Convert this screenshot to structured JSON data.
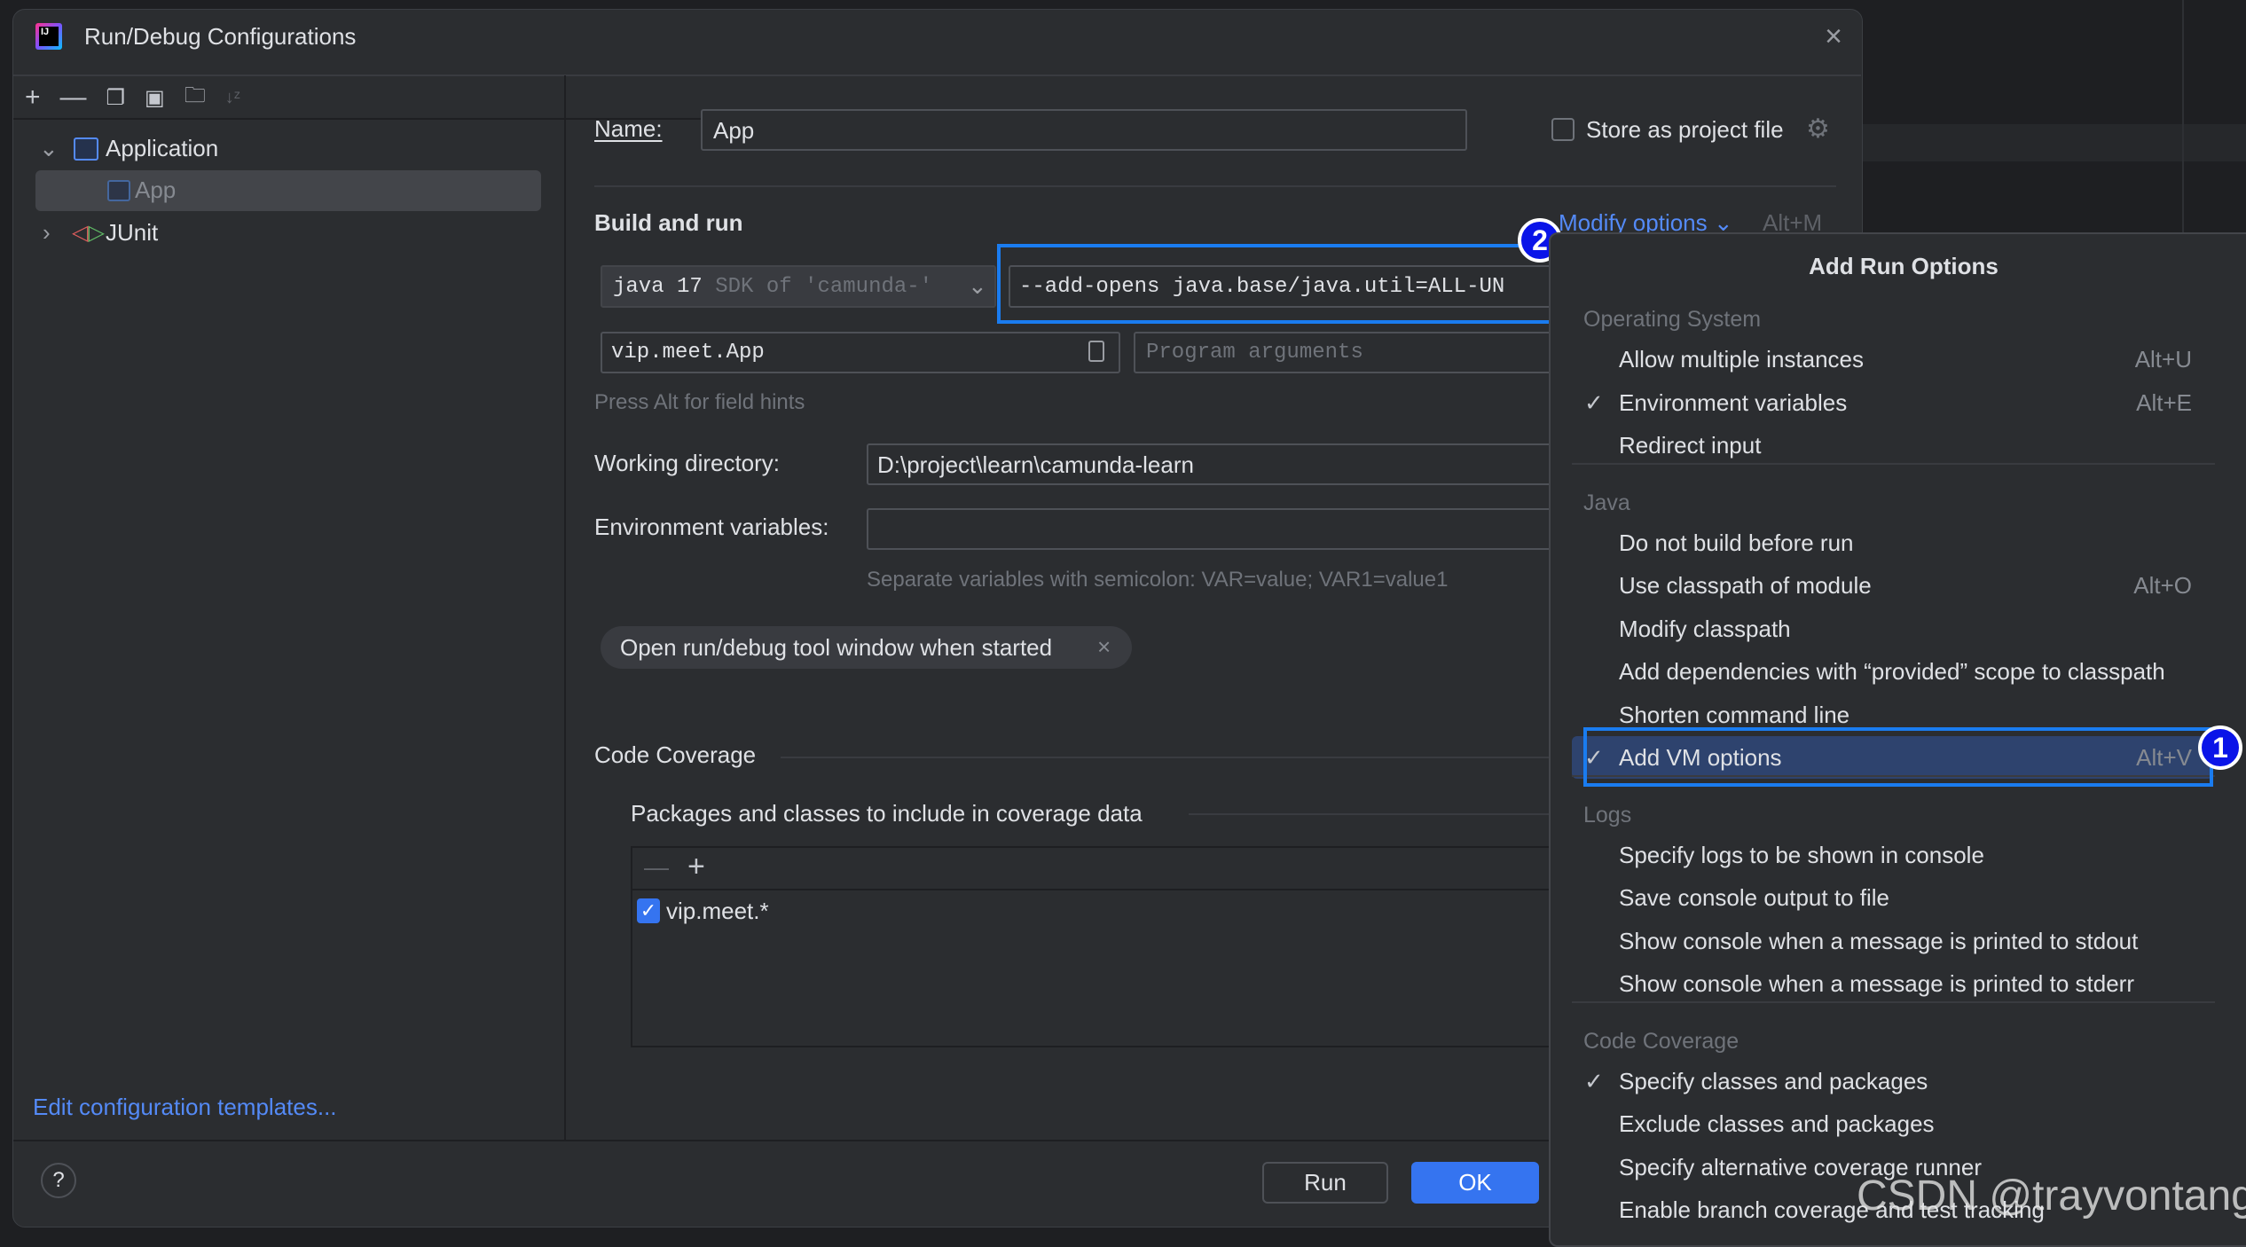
{
  "dialog": {
    "title": "Run/Debug Configurations",
    "close_icon": "close-icon"
  },
  "sidebar": {
    "toolbar_icons": [
      "add-icon",
      "remove-icon",
      "copy-icon",
      "save-icon",
      "new-folder-icon",
      "sort-icon"
    ],
    "tree": [
      {
        "label": "Application",
        "expanded": true,
        "icon": "application-icon"
      },
      {
        "label": "App",
        "selected": true,
        "icon": "application-icon"
      },
      {
        "label": "JUnit",
        "expanded": false,
        "icon": "junit-icon"
      }
    ],
    "edit_templates_link": "Edit configuration templates..."
  },
  "form": {
    "name_label": "Name:",
    "name_value": "App",
    "store_label": "Store as project file",
    "store_checked": false,
    "build_run_title": "Build and run",
    "modify_options": "Modify options",
    "modify_shortcut": "Alt+M",
    "jdk_value": "java 17",
    "jdk_hint": "SDK of 'camunda-'",
    "vm_options_value": "--add-opens java.base/java.util=ALL-UN",
    "main_class_value": "vip.meet.App",
    "program_args_placeholder": "Program arguments",
    "alt_hint": "Press Alt for field hints",
    "working_dir_label": "Working directory:",
    "working_dir_value": "D:\\project\\learn\\camunda-learn",
    "env_label": "Environment variables:",
    "env_value": "",
    "env_hint": "Separate variables with semicolon: VAR=value; VAR1=value1",
    "chip_label": "Open run/debug tool window when started",
    "coverage_title": "Code Coverage",
    "packages_label": "Packages and classes to include in coverage data",
    "packages": [
      {
        "label": "vip.meet.*",
        "checked": true
      }
    ]
  },
  "footer": {
    "help": "?",
    "run_button": "Run",
    "ok_button": "OK"
  },
  "popup": {
    "title": "Add Run Options",
    "items": [
      {
        "type": "header",
        "label": "Operating System"
      },
      {
        "type": "item",
        "label": "Allow multiple instances",
        "shortcut": "Alt+U",
        "checked": false
      },
      {
        "type": "item",
        "label": "Environment variables",
        "shortcut": "Alt+E",
        "checked": true
      },
      {
        "type": "item",
        "label": "Redirect input",
        "shortcut": "",
        "checked": false
      },
      {
        "type": "sep"
      },
      {
        "type": "header",
        "label": "Java"
      },
      {
        "type": "item",
        "label": "Do not build before run",
        "shortcut": "",
        "checked": false
      },
      {
        "type": "item",
        "label": "Use classpath of module",
        "shortcut": "Alt+O",
        "checked": false
      },
      {
        "type": "item",
        "label": "Modify classpath",
        "shortcut": "",
        "checked": false
      },
      {
        "type": "item",
        "label": "Add dependencies with “provided” scope to classpath",
        "shortcut": "",
        "checked": false
      },
      {
        "type": "item",
        "label": "Shorten command line",
        "shortcut": "",
        "checked": false
      },
      {
        "type": "item",
        "label": "Add VM options",
        "shortcut": "Alt+V",
        "checked": true,
        "highlighted": true
      },
      {
        "type": "sep"
      },
      {
        "type": "header",
        "label": "Logs"
      },
      {
        "type": "item",
        "label": "Specify logs to be shown in console",
        "shortcut": "",
        "checked": false
      },
      {
        "type": "item",
        "label": "Save console output to file",
        "shortcut": "",
        "checked": false
      },
      {
        "type": "item",
        "label": "Show console when a message is printed to stdout",
        "shortcut": "",
        "checked": false
      },
      {
        "type": "item",
        "label": "Show console when a message is printed to stderr",
        "shortcut": "",
        "checked": false
      },
      {
        "type": "sep"
      },
      {
        "type": "header",
        "label": "Code Coverage"
      },
      {
        "type": "item",
        "label": "Specify classes and packages",
        "shortcut": "",
        "checked": true
      },
      {
        "type": "item",
        "label": "Exclude classes and packages",
        "shortcut": "",
        "checked": false
      },
      {
        "type": "item",
        "label": "Specify alternative coverage runner",
        "shortcut": "",
        "checked": false
      },
      {
        "type": "item",
        "label": "Enable branch coverage and test tracking",
        "shortcut": "",
        "checked": false
      }
    ]
  },
  "annotations": {
    "badge_1": "1",
    "badge_2": "2"
  },
  "watermark": "CSDN @trayvontang",
  "colors": {
    "accent": "#3574f0",
    "link": "#548af7",
    "annotation": "#1a7cf0",
    "selection": "#2e436e"
  }
}
